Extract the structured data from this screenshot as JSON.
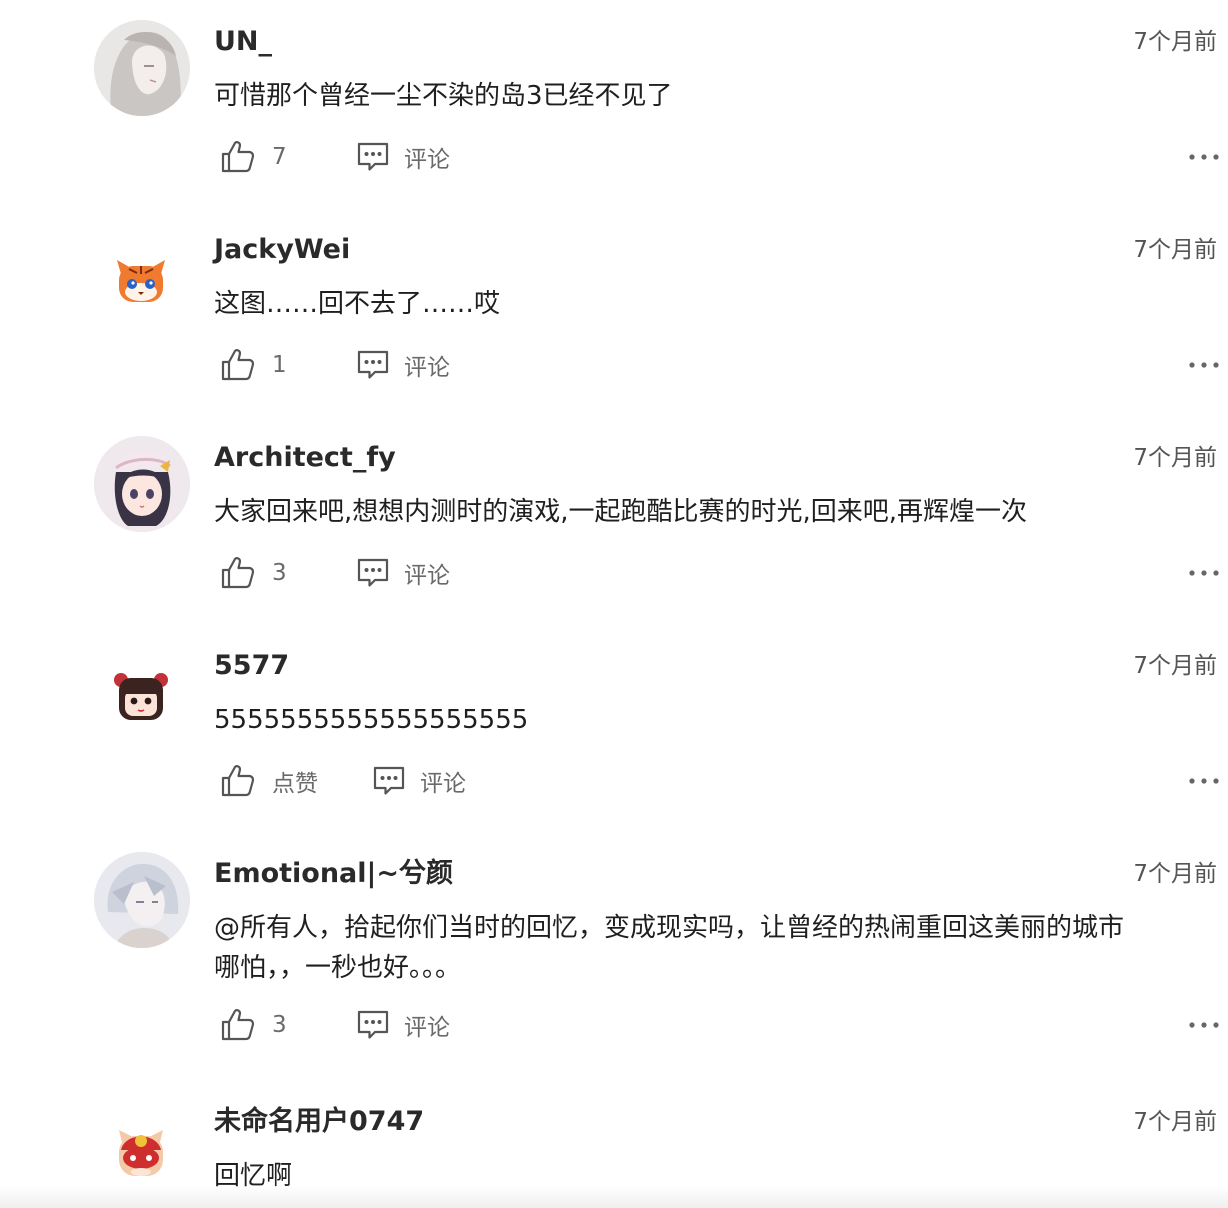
{
  "ui": {
    "reply_label": "评论"
  },
  "comments": [
    {
      "username": "UN_",
      "time": "7个月前",
      "content": "可惜那个曾经一尘不染的岛3已经不见了",
      "likes": "7",
      "avatar_icon": "anime-girl-avatar"
    },
    {
      "username": "JackyWei",
      "time": "7个月前",
      "content": "这图……回不去了……哎",
      "likes": "1",
      "avatar_icon": "tiger-avatar"
    },
    {
      "username": "Architect_fy",
      "time": "7个月前",
      "content": "大家回来吧,想想内测时的演戏,一起跑酷比赛的时光,回来吧,再辉煌一次",
      "likes": "3",
      "avatar_icon": "anime-girl-hat-avatar"
    },
    {
      "username": "5577",
      "time": "7个月前",
      "content": "5555555555555555555",
      "likes": "点赞",
      "avatar_icon": "girl-bun-avatar"
    },
    {
      "username": "Emotional|~兮颜",
      "time": "7个月前",
      "content": "@所有人，拾起你们当时的回忆，变成现实吗，让曾经的热闹重回这美丽的城市\n哪怕，，一秒也好。。。",
      "likes": "3",
      "avatar_icon": "anime-boy-avatar"
    },
    {
      "username": "未命名用户0747",
      "time": "7个月前",
      "content": "回忆啊",
      "likes": "",
      "avatar_icon": "red-cat-avatar"
    }
  ]
}
